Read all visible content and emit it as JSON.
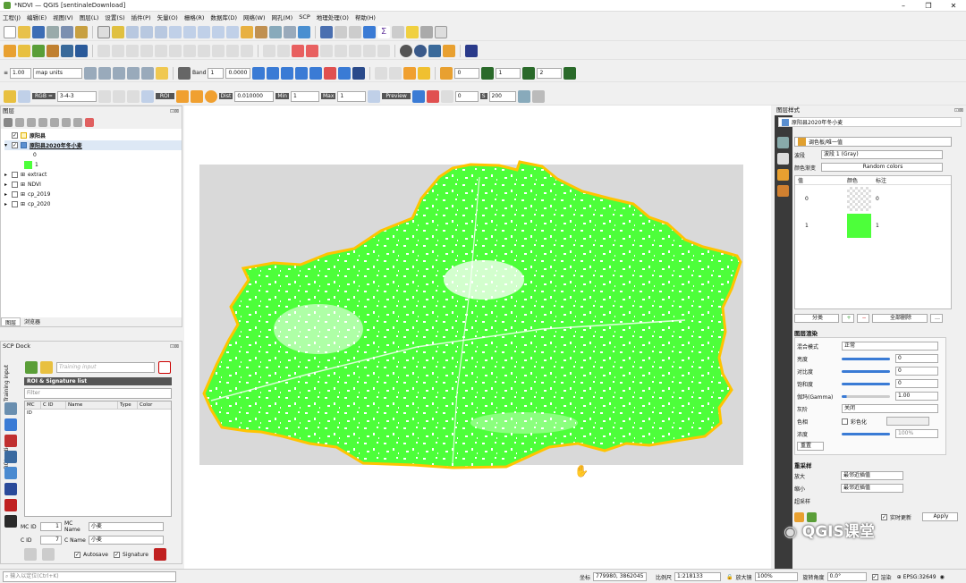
{
  "window": {
    "title": "*NDVI — QGIS [sentinaleDownload]",
    "min": "–",
    "max": "❐",
    "close": "✕"
  },
  "menu": [
    "工程(J)",
    "编辑(E)",
    "视图(V)",
    "图层(L)",
    "设置(S)",
    "插件(P)",
    "矢量(O)",
    "栅格(R)",
    "数据库(D)",
    "网络(W)",
    "网孔(M)",
    "SCP",
    "地理处理(O)",
    "帮助(H)"
  ],
  "toolbar3": {
    "scale": "1.00",
    "units": "map units",
    "band": "Band",
    "band_val": "1",
    "val": "0.0000",
    "n1": "0",
    "n2": "1",
    "n3": "2"
  },
  "toolbar4": {
    "rgb_label": "RGB =",
    "rgb": "3-4-3",
    "roi": "ROI",
    "dist_label": "Dist",
    "dist": "0.010000",
    "min_label": "Min",
    "min": "1",
    "max_label": "Max",
    "max": "1",
    "preview": "Preview",
    "t": "0",
    "s_label": "S",
    "s": "200"
  },
  "layers_panel": {
    "title": "图层",
    "items": [
      {
        "name": "原阳县",
        "checked": true,
        "bold": true
      },
      {
        "name": "原阳县2020年冬小麦",
        "checked": true,
        "bold": true
      },
      {
        "name": "0"
      },
      {
        "name": "1"
      },
      {
        "name": "extract",
        "checked": false
      },
      {
        "name": "NDVI",
        "checked": false
      },
      {
        "name": "cp_2019",
        "checked": false
      },
      {
        "name": "cp_2020",
        "checked": false
      }
    ],
    "tabs": [
      "图层",
      "浏览器"
    ]
  },
  "scp": {
    "title": "SCP Dock",
    "training_input": "Training input",
    "roi_list": "ROI & Signature list",
    "filter": "Filter",
    "cols": [
      "MC ID",
      "C ID",
      "Name",
      "Type",
      "Color"
    ],
    "mc_id_label": "MC ID",
    "mc_id": "1",
    "mc_name_label": "MC Name",
    "mc_name": "小麦",
    "c_id_label": "C ID",
    "c_id": "7",
    "c_name_label": "C Name",
    "c_name": "小麦",
    "autosave": "Autosave",
    "signature": "Signature",
    "side_tabs": [
      "Training input",
      "ROI options"
    ]
  },
  "style_panel": {
    "title": "图层样式",
    "layer": "原阳县2020年冬小麦",
    "renderer": "调色板/唯一值",
    "band_label": "波段",
    "band": "波段 1 (Gray)",
    "ramp_label": "颜色渐变",
    "ramp": "Random colors",
    "cols": [
      "值",
      "颜色",
      "标注"
    ],
    "rows": [
      {
        "value": "0",
        "label": "0"
      },
      {
        "value": "1",
        "label": "1"
      }
    ],
    "btn_classify": "分类",
    "btn_delete_all": "全部删除",
    "render_title": "图层渲染",
    "blend_label": "混合模式",
    "blend": "正常",
    "brightness_label": "亮度",
    "brightness": "0",
    "contrast_label": "对比度",
    "contrast": "0",
    "saturation_label": "饱和度",
    "saturation": "0",
    "gamma_label": "伽玛(Gamma)",
    "gamma": "1.00",
    "gray_label": "灰阶",
    "gray": "关闭",
    "hue_label": "色相",
    "colorize": "彩色化",
    "strength_label": "浓度",
    "strength": "100%",
    "reset": "重置",
    "resample_title": "重采样",
    "zoom_in_label": "放大",
    "zoom_in": "最邻近插值",
    "zoom_out_label": "缩小",
    "zoom_out": "最邻近插值",
    "oversample_label": "超采样",
    "live_update": "实时更新",
    "apply": "Apply"
  },
  "status": {
    "search": "输入以定位(Ctrl+K)",
    "coord_label": "坐标",
    "coord": "779980, 3862045",
    "scale_label": "比例尺",
    "scale": "1:218133",
    "mag_label": "放大镜",
    "mag": "100%",
    "rot_label": "旋转角度",
    "rot": "0.0°",
    "render": "渲染",
    "crs": "EPSG:32649"
  },
  "watermark": "QGIS课堂",
  "colors": {
    "fill": "#4dff3a",
    "boundary": "#ffc400",
    "bg": "#d9d9d9"
  }
}
